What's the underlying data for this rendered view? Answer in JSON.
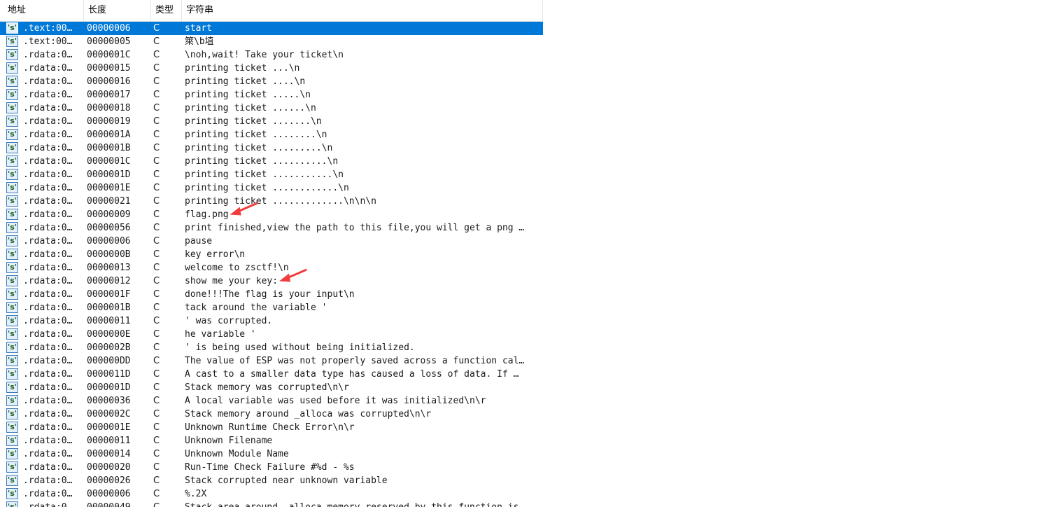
{
  "strings_window": {
    "columns": {
      "address": "地址",
      "length": "长度",
      "type": "类型",
      "string": "字符串"
    },
    "icon_label": "'s'",
    "selected_index": 0,
    "rows": [
      {
        "address": ".text:00…",
        "length": "00000006",
        "type": "C",
        "string": "start"
      },
      {
        "address": ".text:00…",
        "length": "00000005",
        "type": "C",
        "string": "箂\\b埴"
      },
      {
        "address": ".rdata:0…",
        "length": "0000001C",
        "type": "C",
        "string": "\\noh,wait! Take your ticket\\n"
      },
      {
        "address": ".rdata:0…",
        "length": "00000015",
        "type": "C",
        "string": "printing ticket ...\\n"
      },
      {
        "address": ".rdata:0…",
        "length": "00000016",
        "type": "C",
        "string": "printing ticket ....\\n"
      },
      {
        "address": ".rdata:0…",
        "length": "00000017",
        "type": "C",
        "string": "printing ticket .....\\n"
      },
      {
        "address": ".rdata:0…",
        "length": "00000018",
        "type": "C",
        "string": "printing ticket ......\\n"
      },
      {
        "address": ".rdata:0…",
        "length": "00000019",
        "type": "C",
        "string": "printing ticket .......\\n"
      },
      {
        "address": ".rdata:0…",
        "length": "0000001A",
        "type": "C",
        "string": "printing ticket ........\\n"
      },
      {
        "address": ".rdata:0…",
        "length": "0000001B",
        "type": "C",
        "string": "printing ticket .........\\n"
      },
      {
        "address": ".rdata:0…",
        "length": "0000001C",
        "type": "C",
        "string": "printing ticket ..........\\n"
      },
      {
        "address": ".rdata:0…",
        "length": "0000001D",
        "type": "C",
        "string": "printing ticket ...........\\n"
      },
      {
        "address": ".rdata:0…",
        "length": "0000001E",
        "type": "C",
        "string": "printing ticket ............\\n"
      },
      {
        "address": ".rdata:0…",
        "length": "00000021",
        "type": "C",
        "string": "printing ticket .............\\n\\n\\n"
      },
      {
        "address": ".rdata:0…",
        "length": "00000009",
        "type": "C",
        "string": "flag.png"
      },
      {
        "address": ".rdata:0…",
        "length": "00000056",
        "type": "C",
        "string": "print finished,view the path to this file,you will get a png …"
      },
      {
        "address": ".rdata:0…",
        "length": "00000006",
        "type": "C",
        "string": "pause"
      },
      {
        "address": ".rdata:0…",
        "length": "0000000B",
        "type": "C",
        "string": "key error\\n"
      },
      {
        "address": ".rdata:0…",
        "length": "00000013",
        "type": "C",
        "string": "welcome to zsctf!\\n"
      },
      {
        "address": ".rdata:0…",
        "length": "00000012",
        "type": "C",
        "string": "show me your key:"
      },
      {
        "address": ".rdata:0…",
        "length": "0000001F",
        "type": "C",
        "string": "done!!!The flag is your input\\n"
      },
      {
        "address": ".rdata:0…",
        "length": "0000001B",
        "type": "C",
        "string": "tack around the variable '"
      },
      {
        "address": ".rdata:0…",
        "length": "00000011",
        "type": "C",
        "string": "' was corrupted."
      },
      {
        "address": ".rdata:0…",
        "length": "0000000E",
        "type": "C",
        "string": "he variable '"
      },
      {
        "address": ".rdata:0…",
        "length": "0000002B",
        "type": "C",
        "string": "' is being used without being initialized."
      },
      {
        "address": ".rdata:0…",
        "length": "000000DD",
        "type": "C",
        "string": "The value of ESP was not properly saved across a function cal…"
      },
      {
        "address": ".rdata:0…",
        "length": "0000011D",
        "type": "C",
        "string": "A cast to a smaller data type has caused a loss of data.  If …"
      },
      {
        "address": ".rdata:0…",
        "length": "0000001D",
        "type": "C",
        "string": "Stack memory was corrupted\\n\\r"
      },
      {
        "address": ".rdata:0…",
        "length": "00000036",
        "type": "C",
        "string": "A local variable was used before it was initialized\\n\\r"
      },
      {
        "address": ".rdata:0…",
        "length": "0000002C",
        "type": "C",
        "string": "Stack memory around _alloca was corrupted\\n\\r"
      },
      {
        "address": ".rdata:0…",
        "length": "0000001E",
        "type": "C",
        "string": "Unknown Runtime Check Error\\n\\r"
      },
      {
        "address": ".rdata:0…",
        "length": "00000011",
        "type": "C",
        "string": "Unknown Filename"
      },
      {
        "address": ".rdata:0…",
        "length": "00000014",
        "type": "C",
        "string": "Unknown Module Name"
      },
      {
        "address": ".rdata:0…",
        "length": "00000020",
        "type": "C",
        "string": "Run-Time Check Failure #%d - %s"
      },
      {
        "address": ".rdata:0…",
        "length": "00000026",
        "type": "C",
        "string": "Stack corrupted near unknown variable"
      },
      {
        "address": ".rdata:0…",
        "length": "00000006",
        "type": "C",
        "string": "%.2X"
      },
      {
        "address": ".rdata:0…",
        "length": "00000049",
        "type": "C",
        "string": "Stack area around _alloca memory reserved by this function is…"
      }
    ]
  },
  "annotations": {
    "arrow_color": "#f03c3c",
    "arrow_rows": [
      14,
      19
    ]
  },
  "colors": {
    "selection": "#0078d7",
    "header_border": "#e5e5e5"
  }
}
